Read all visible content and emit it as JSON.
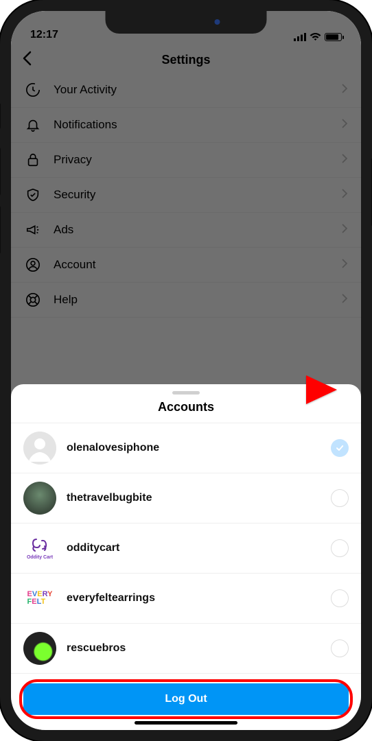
{
  "status_bar": {
    "time": "12:17"
  },
  "header": {
    "title": "Settings"
  },
  "settings_items": [
    {
      "label": "Your Activity",
      "icon": "activity-icon"
    },
    {
      "label": "Notifications",
      "icon": "bell-icon"
    },
    {
      "label": "Privacy",
      "icon": "lock-icon"
    },
    {
      "label": "Security",
      "icon": "shield-icon"
    },
    {
      "label": "Ads",
      "icon": "megaphone-icon"
    },
    {
      "label": "Account",
      "icon": "person-icon"
    },
    {
      "label": "Help",
      "icon": "lifebuoy-icon"
    }
  ],
  "sheet": {
    "title": "Accounts",
    "accounts": [
      {
        "username": "olenalovesiphone",
        "selected": true,
        "avatar": "placeholder"
      },
      {
        "username": "thetravelbugbite",
        "selected": false,
        "avatar": "travel"
      },
      {
        "username": "odditycart",
        "selected": false,
        "avatar": "oddity",
        "avatar_text": "Oddity Cart"
      },
      {
        "username": "everyfeltearrings",
        "selected": false,
        "avatar": "every",
        "avatar_text": "EVERY FELT"
      },
      {
        "username": "rescuebros",
        "selected": false,
        "avatar": "rescue"
      }
    ],
    "logout_label": "Log Out"
  },
  "colors": {
    "primary_button": "#0095f6",
    "highlight": "#ff0000",
    "selected_check": "#c1e3ff"
  }
}
